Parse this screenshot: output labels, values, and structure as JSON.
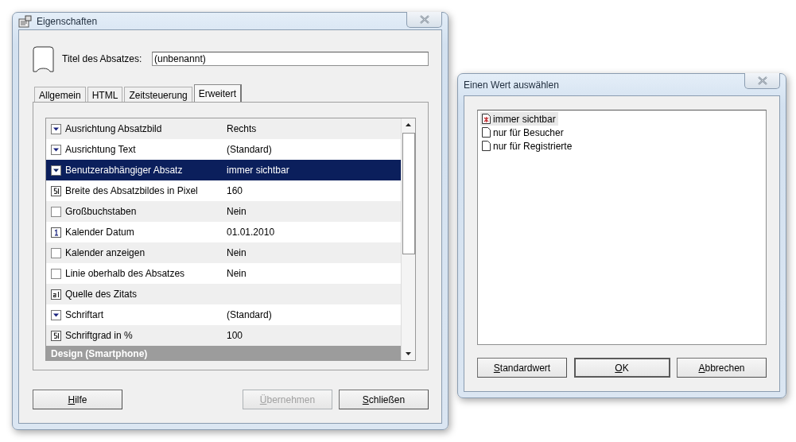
{
  "properties_window": {
    "title": "Eigenschaften",
    "title_label": "Titel des Absatzes:",
    "title_value": "(unbenannt)",
    "tabs": [
      {
        "label": "Allgemein",
        "selected": false
      },
      {
        "label": "HTML",
        "selected": false
      },
      {
        "label": "Zeitsteuerung",
        "selected": false
      },
      {
        "label": "Erweitert",
        "selected": true
      }
    ],
    "rows": [
      {
        "kind": "dropdown",
        "name": "Ausrichtung Absatzbild",
        "value": "Rechts",
        "selected": false
      },
      {
        "kind": "dropdown",
        "name": "Ausrichtung Text",
        "value": "(Standard)",
        "selected": false
      },
      {
        "kind": "dropdown",
        "name": "Benutzerabhängiger Absatz",
        "value": "immer sichtbar",
        "selected": true
      },
      {
        "kind": "number",
        "name": "Breite des Absatzbildes in Pixel",
        "value": "160",
        "selected": false
      },
      {
        "kind": "checkbox",
        "name": "Großbuchstaben",
        "value": "Nein",
        "selected": false,
        "checked": false
      },
      {
        "kind": "date",
        "name": "Kalender Datum",
        "value": "01.01.2010",
        "selected": false
      },
      {
        "kind": "checkbox",
        "name": "Kalender anzeigen",
        "value": "Nein",
        "selected": false,
        "checked": false
      },
      {
        "kind": "checkbox",
        "name": "Linie oberhalb des Absatzes",
        "value": "Nein",
        "selected": false,
        "checked": false
      },
      {
        "kind": "text",
        "name": "Quelle des Zitats",
        "selected": false
      },
      {
        "kind": "dropdown",
        "name": "Schriftart",
        "value": "(Standard)",
        "selected": false
      },
      {
        "kind": "number",
        "name": "Schriftgrad in %",
        "value": "100",
        "selected": false
      },
      {
        "kind": "category",
        "name": "Design (Smartphone)",
        "selected": false
      }
    ],
    "buttons": [
      {
        "label": "Hilfe",
        "disabled": false,
        "default": false
      },
      {
        "label": "Übernehmen",
        "disabled": true,
        "default": false
      },
      {
        "label": "Schließen",
        "disabled": false,
        "default": false
      }
    ]
  },
  "value_window": {
    "title": "Einen Wert auswählen",
    "options": [
      {
        "label": "immer sichtbar",
        "selected": true
      },
      {
        "label": "nur für Besucher",
        "selected": false
      },
      {
        "label": "nur für Registrierte",
        "selected": false
      }
    ],
    "buttons": [
      {
        "label": "Standardwert",
        "disabled": false,
        "default": false
      },
      {
        "label": "OK",
        "disabled": false,
        "default": true
      },
      {
        "label": "Abbrechen",
        "disabled": false,
        "default": false
      }
    ]
  }
}
